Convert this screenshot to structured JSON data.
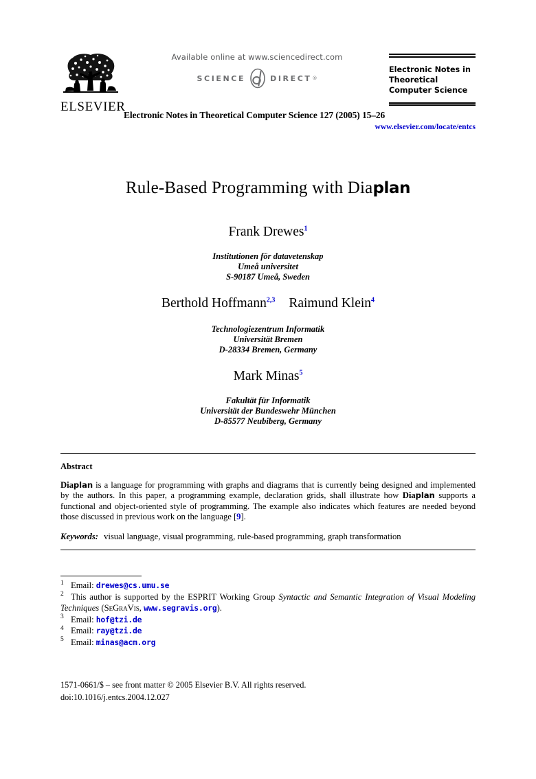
{
  "masthead": {
    "publisher_name": "ELSEVIER",
    "publisher_logo_icon": "elsevier-tree-logo",
    "available_online": "Available online at www.sciencedirect.com",
    "sciencedirect_left": "SCIENCE",
    "sciencedirect_mark_icon": "sciencedirect-d-mark",
    "sciencedirect_right": "DIRECT",
    "sciencedirect_reg": "®",
    "journal_citation": "Electronic Notes in Theoretical Computer Science 127 (2005) 15–26",
    "series_title": "Electronic Notes in Theoretical Computer Science",
    "series_url": "www.elsevier.com/locate/entcs"
  },
  "title": {
    "part_plain": "Rule-Based Programming with Dia",
    "part_logo": "plan"
  },
  "authors": [
    {
      "name": "Frank Drewes",
      "footnotes": "1",
      "affiliation": [
        "Institutionen för datavetenskap",
        "Umeå universitet",
        "S-90187 Umeå, Sweden"
      ]
    },
    {
      "name": "Berthold Hoffmann",
      "footnotes": "2,3",
      "name2": "Raimund Klein",
      "footnotes2": "4",
      "affiliation": [
        "Technologiezentrum Informatik",
        "Universität Bremen",
        "D-28334 Bremen, Germany"
      ]
    },
    {
      "name": "Mark Minas",
      "footnotes": "5",
      "affiliation": [
        "Fakultät für Informatik",
        "Universität der Bundeswehr München",
        "D-85577 Neubiberg, Germany"
      ]
    }
  ],
  "abstract": {
    "heading": "Abstract",
    "logo_dia": "Dia",
    "logo_plan": "plan",
    "body_part1": " is a language for programming with graphs and diagrams that is currently being designed and implemented by the authors. In this paper, a programming example, declaration grids, shall illustrate how ",
    "body_part2": " supports a functional and object-oriented style of programming. The example also indicates which features are needed beyond those discussed in previous work on the language [",
    "citation": "9",
    "body_part3": "]."
  },
  "keywords": {
    "label": "Keywords:",
    "list": "visual language, visual programming, rule-based programming, graph transformation"
  },
  "footnotes": [
    {
      "num": "1",
      "text_before": "Email: ",
      "link": "drewes@cs.umu.se",
      "text_after": ""
    },
    {
      "num": "2",
      "text_before": "This author is supported by the ESPRIT Working Group ",
      "italic_title": "Syntactic and Semantic Integration of Visual Modeling Techniques",
      "text_mid": " (",
      "smallcaps": "SeGraVis",
      "text_mid2": ", ",
      "link": "www.segravis.org",
      "text_after": ")."
    },
    {
      "num": "3",
      "text_before": "Email: ",
      "link": "hof@tzi.de",
      "text_after": ""
    },
    {
      "num": "4",
      "text_before": "Email: ",
      "link": "ray@tzi.de",
      "text_after": ""
    },
    {
      "num": "5",
      "text_before": "Email: ",
      "link": "minas@acm.org",
      "text_after": ""
    }
  ],
  "copyright": {
    "line1": "1571-0661/$ – see front matter © 2005 Elsevier B.V. All rights reserved.",
    "line2": "doi:10.1016/j.entcs.2004.12.027"
  },
  "colors": {
    "link_blue": "#0000cc",
    "sciencedirect_gray": "#6d6e70",
    "text_black": "#000000"
  }
}
